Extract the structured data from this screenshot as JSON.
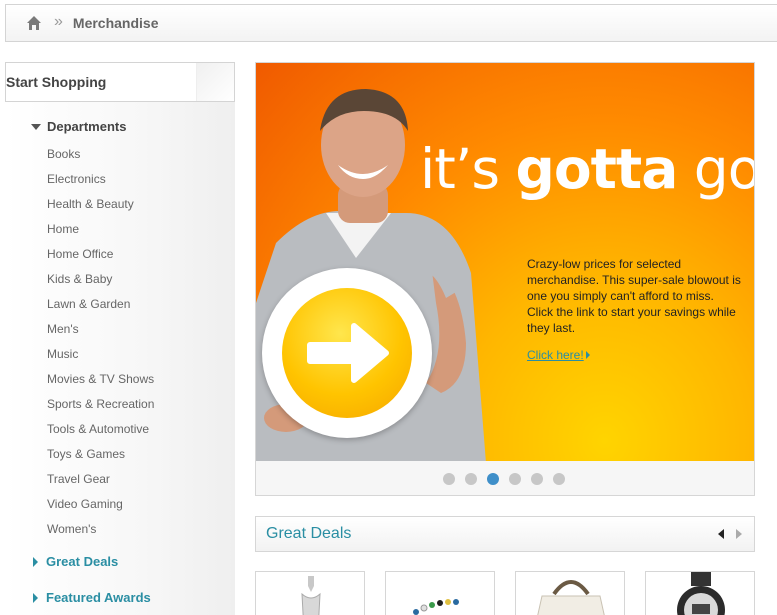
{
  "breadcrumb": {
    "home_icon": "home-icon",
    "separator": "»",
    "current": "Merchandise"
  },
  "sidebar": {
    "header": "Start Shopping",
    "departments_label": "Departments",
    "departments": [
      "Books",
      "Electronics",
      "Health & Beauty",
      "Home",
      "Home Office",
      "Kids & Baby",
      "Lawn & Garden",
      "Men's",
      "Music",
      "Movies & TV Shows",
      "Sports & Recreation",
      "Tools & Automotive",
      "Toys & Games",
      "Travel Gear",
      "Video Gaming",
      "Women's"
    ],
    "great_deals": "Great Deals",
    "featured_awards": "Featured Awards"
  },
  "hero": {
    "title_light_1": "it’s ",
    "title_bold": "gotta",
    "title_light_2": " go!",
    "copy": "Crazy-low prices for selected merchandise. This super-sale blowout is one you simply can't afford to miss. Click the link to start your savings while they last.",
    "link": "Click here!",
    "slide_count": 6,
    "active_slide": 3
  },
  "deals": {
    "title": "Great Deals",
    "prev_icon": "arrow-left-icon",
    "next_icon": "arrow-right-icon"
  },
  "colors": {
    "accent": "#2a8ea3",
    "hero_orange": "#ff8a00",
    "dot_active": "#3f8fc9"
  }
}
